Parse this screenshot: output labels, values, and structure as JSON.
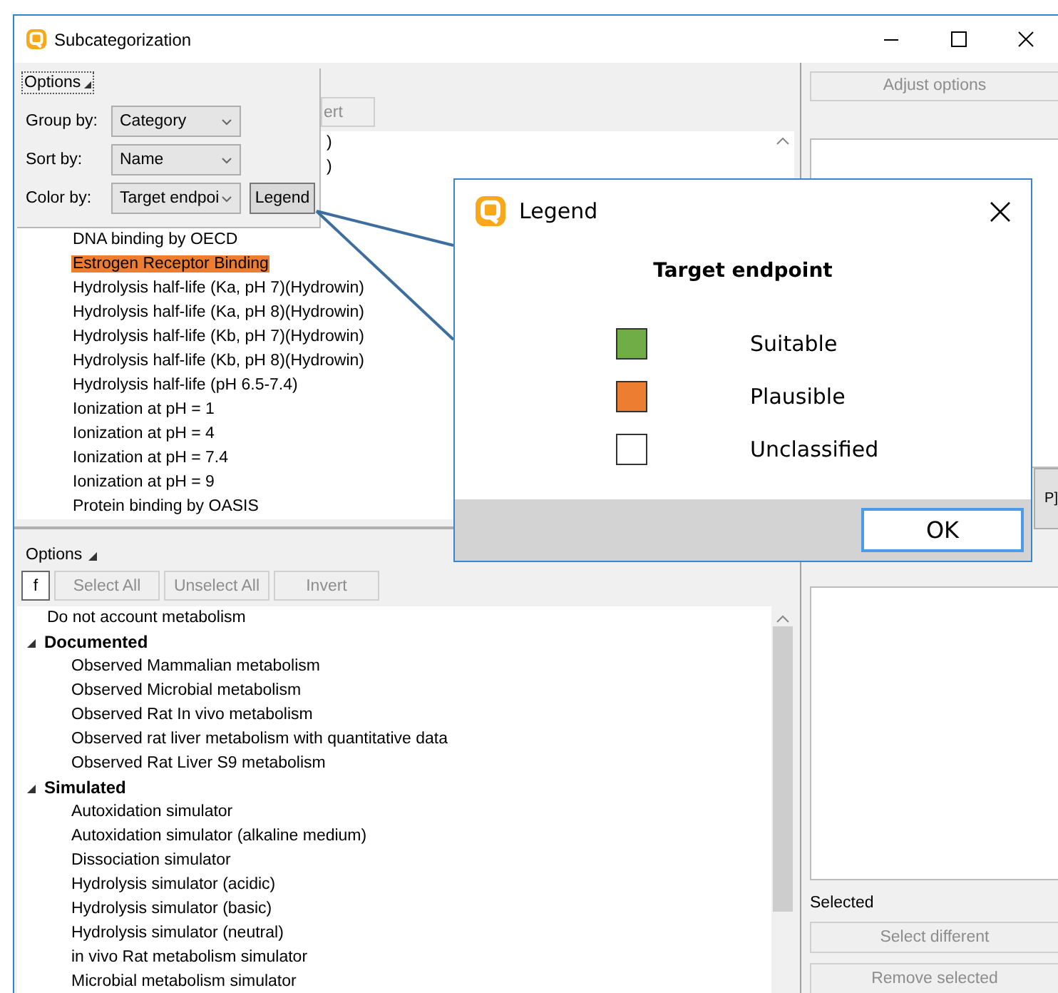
{
  "window": {
    "title": "Subcategorization"
  },
  "top_panel": {
    "toolbar_fragment": "ert",
    "row_fragments": [
      ")",
      ")"
    ],
    "rows": [
      {
        "label": "DNA binding by OECD"
      },
      {
        "label": "Estrogen Receptor Binding",
        "color": "#ed7d31"
      },
      {
        "label": "Hydrolysis half-life (Ka, pH 7)(Hydrowin)"
      },
      {
        "label": "Hydrolysis half-life (Ka, pH 8)(Hydrowin)"
      },
      {
        "label": "Hydrolysis half-life (Kb, pH 7)(Hydrowin)"
      },
      {
        "label": "Hydrolysis half-life (Kb, pH 8)(Hydrowin)"
      },
      {
        "label": "Hydrolysis half-life (pH 6.5-7.4)"
      },
      {
        "label": "Ionization at pH = 1"
      },
      {
        "label": "Ionization at pH = 4"
      },
      {
        "label": "Ionization at pH = 7.4"
      },
      {
        "label": "Ionization at pH = 9"
      },
      {
        "label": "Protein binding by OASIS"
      }
    ]
  },
  "options_popup": {
    "title": "Options",
    "expanded": true,
    "fields": [
      {
        "label": "Group by:",
        "value": "Category"
      },
      {
        "label": "Sort by:",
        "value": "Name"
      },
      {
        "label": "Color by:",
        "value": "Target endpoi"
      }
    ],
    "legend_button": "Legend"
  },
  "legend_dialog": {
    "title": "Legend",
    "heading": "Target endpoint",
    "entries": [
      {
        "label": "Suitable",
        "color": "#70ad47"
      },
      {
        "label": "Plausible",
        "color": "#ed7d31"
      },
      {
        "label": "Unclassified",
        "color": "#ffffff"
      }
    ],
    "ok_button": "OK"
  },
  "bottom_panel": {
    "options": "Options",
    "expanded": true,
    "filter_button": "f",
    "buttons": [
      {
        "label": "Select All",
        "disabled": true
      },
      {
        "label": "Unselect All",
        "disabled": true
      },
      {
        "label": "Invert",
        "disabled": true
      }
    ],
    "tree": [
      {
        "label": "Do not account metabolism"
      },
      {
        "label": "Documented",
        "expanded": true,
        "children": [
          {
            "label": "Observed Mammalian metabolism"
          },
          {
            "label": "Observed Microbial metabolism"
          },
          {
            "label": "Observed Rat In vivo metabolism"
          },
          {
            "label": "Observed rat liver metabolism with quantitative data"
          },
          {
            "label": "Observed Rat Liver S9  metabolism"
          }
        ]
      },
      {
        "label": "Simulated",
        "expanded": true,
        "children": [
          {
            "label": "Autoxidation simulator"
          },
          {
            "label": "Autoxidation simulator (alkaline medium)"
          },
          {
            "label": "Dissociation simulator"
          },
          {
            "label": "Hydrolysis simulator (acidic)"
          },
          {
            "label": "Hydrolysis simulator (basic)"
          },
          {
            "label": "Hydrolysis simulator (neutral)"
          },
          {
            "label": "in vivo Rat metabolism simulator"
          },
          {
            "label": "Microbial metabolism simulator"
          }
        ]
      }
    ]
  },
  "right_panel": {
    "adjust_button": {
      "label": "Adjust options",
      "disabled": true
    },
    "button_fragment": "P]",
    "selected_label": "Selected",
    "buttons": [
      {
        "label": "Select different",
        "disabled": true
      },
      {
        "label": "Remove selected",
        "disabled": true
      }
    ]
  }
}
